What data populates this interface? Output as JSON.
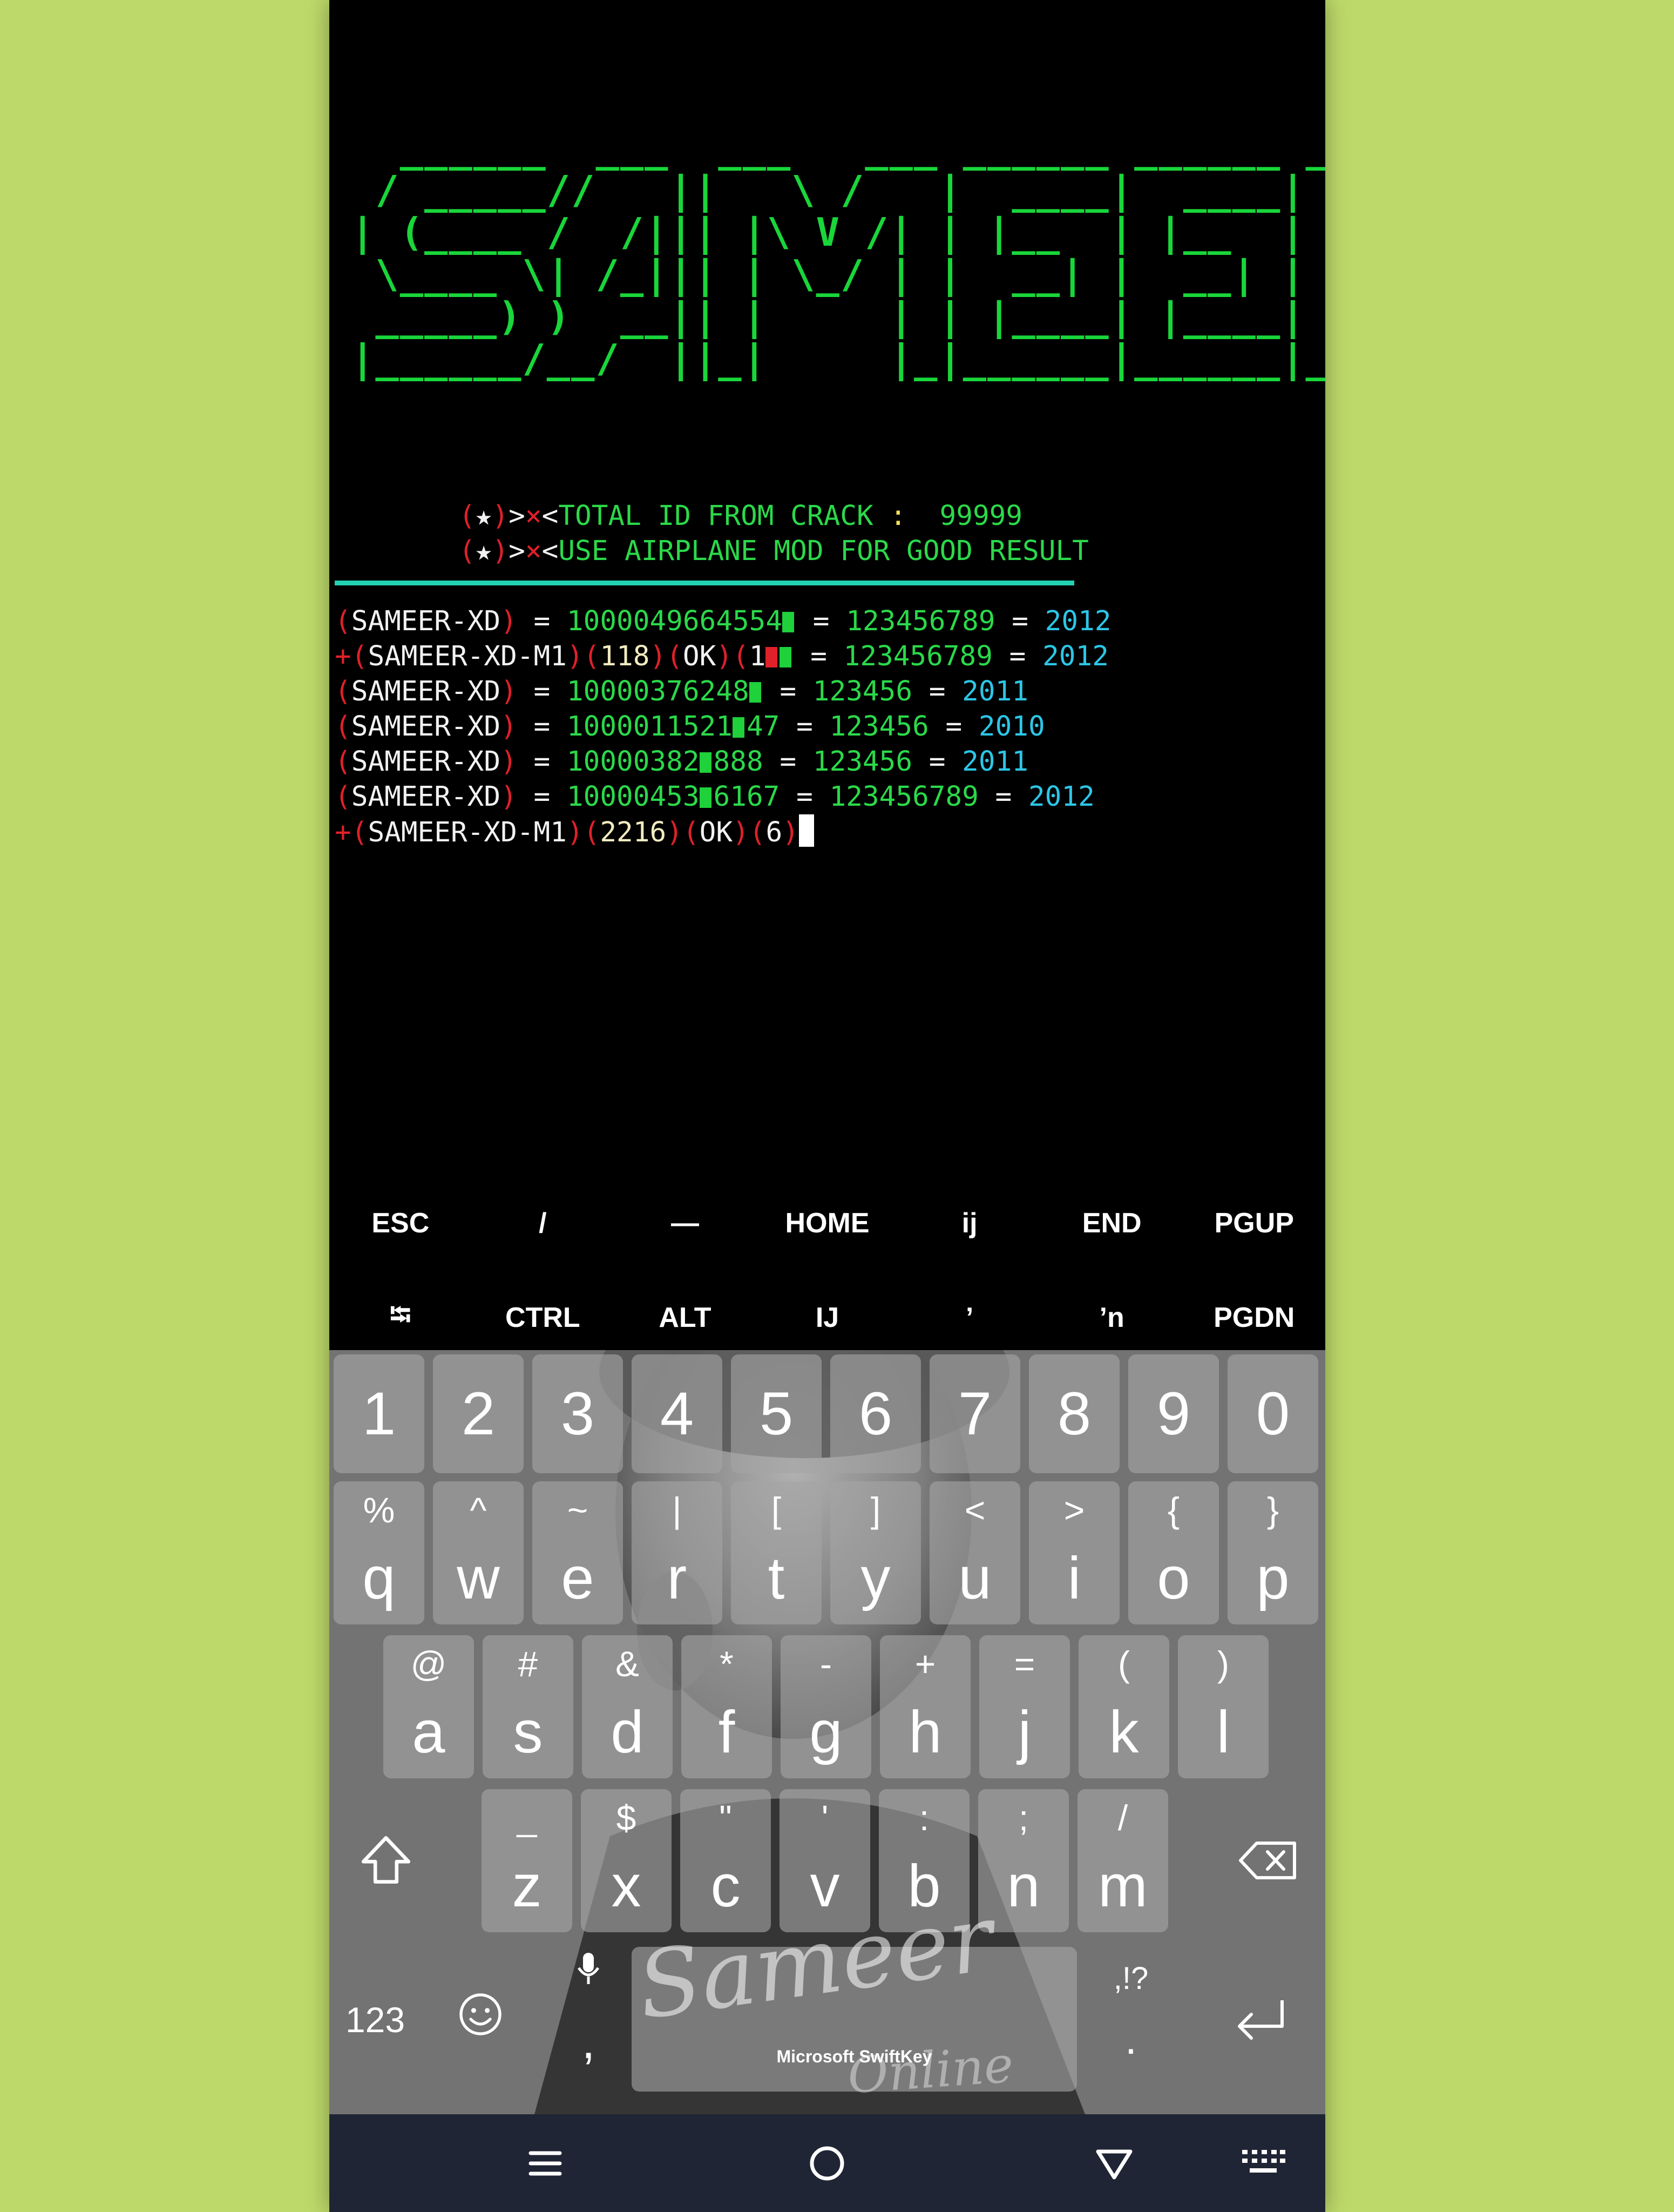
{
  "terminal": {
    "banner": [
      "  ______  ___  ___   ___ ______ ______ _____",
      " / _____//   ||   \\ /   |  ____|  ____|  __ \\",
      "| (____ /  /||| |\\ V /| | |__  | |__  | |__) |",
      " \\____ \\| /_||| | \\_/ | |  __| |  __| |  _  /",
      " _____) )  __|| |     | | |____| |____| | \\ \\",
      "|______/__/  ||_|     |_|______|______|_|  \\_\\"
    ],
    "info_lines": [
      {
        "prefix": "(",
        "star": "★",
        "suffix": ")>",
        "x": "×",
        "lt": "<",
        "text": "TOTAL ID FROM CRACK",
        "colon": " : ",
        "value": " 99999"
      },
      {
        "prefix": "(",
        "star": "★",
        "suffix": ")>",
        "x": "×",
        "lt": "<",
        "text": "USE AIRPLANE MOD FOR GOOD RESULT",
        "colon": "",
        "value": ""
      }
    ],
    "log_rows": [
      {
        "plus": "",
        "tag": "SAMEER-XD",
        "id": "1000049664554",
        "pass": "123456789",
        "year": "2012"
      },
      {
        "plus": "+",
        "tag": "SAMEER-XD-M1",
        "count": "118",
        "ok": "OK",
        "id": "1",
        "pass": "123456789",
        "year": "2012"
      },
      {
        "plus": "",
        "tag": "SAMEER-XD",
        "id": "10000376248",
        "pass": "123456",
        "year": "2011"
      },
      {
        "plus": "",
        "tag": "SAMEER-XD",
        "id": "1000011521",
        "id_tail": "47",
        "pass": "123456",
        "year": "2010"
      },
      {
        "plus": "",
        "tag": "SAMEER-XD",
        "id": "10000382",
        "id_tail": "888",
        "pass": "123456",
        "year": "2011"
      },
      {
        "plus": "",
        "tag": "SAMEER-XD",
        "id": "10000453",
        "id_tail": "6167",
        "pass": "123456789",
        "year": "2012"
      }
    ],
    "last_line": {
      "plus": "+",
      "tag": "SAMEER-XD-M1",
      "count": "2216",
      "ok": "OK",
      "num": "6"
    }
  },
  "extra_keys": {
    "row1": [
      "ESC",
      "/",
      "—",
      "HOME",
      "ij",
      "END",
      "PGUP"
    ],
    "row2": [
      "⭾",
      "CTRL",
      "ALT",
      "IJ",
      "’",
      "ʼn",
      "PGDN"
    ]
  },
  "keyboard": {
    "numbers": [
      "1",
      "2",
      "3",
      "4",
      "5",
      "6",
      "7",
      "8",
      "9",
      "0"
    ],
    "row_q": [
      {
        "sub": "%",
        "main": "q"
      },
      {
        "sub": "^",
        "main": "w"
      },
      {
        "sub": "~",
        "main": "e"
      },
      {
        "sub": "|",
        "main": "r"
      },
      {
        "sub": "[",
        "main": "t"
      },
      {
        "sub": "]",
        "main": "y"
      },
      {
        "sub": "<",
        "main": "u"
      },
      {
        "sub": ">",
        "main": "i"
      },
      {
        "sub": "{",
        "main": "o"
      },
      {
        "sub": "}",
        "main": "p"
      }
    ],
    "row_a": [
      {
        "sub": "@",
        "main": "a"
      },
      {
        "sub": "#",
        "main": "s"
      },
      {
        "sub": "&",
        "main": "d"
      },
      {
        "sub": "*",
        "main": "f"
      },
      {
        "sub": "-",
        "main": "g"
      },
      {
        "sub": "+",
        "main": "h"
      },
      {
        "sub": "=",
        "main": "j"
      },
      {
        "sub": "(",
        "main": "k"
      },
      {
        "sub": ")",
        "main": "l"
      }
    ],
    "row_z": [
      {
        "sub": "_",
        "main": "z"
      },
      {
        "sub": "$",
        "main": "x"
      },
      {
        "sub": "\"",
        "main": "c"
      },
      {
        "sub": "'",
        "main": "v"
      },
      {
        "sub": ":",
        "main": "b"
      },
      {
        "sub": ";",
        "main": "n"
      },
      {
        "sub": "/",
        "main": "m"
      }
    ],
    "shift_icon": "shift-icon",
    "backspace_icon": "backspace-icon",
    "symbols_label": "123",
    "comma": ",",
    "punct_label": ",!?",
    "period": ".",
    "space_brand": "Microsoft SwiftKey",
    "watermark": "Sameer",
    "watermark2": "Online"
  },
  "navbar": {
    "icons": [
      "menu-icon",
      "home-icon",
      "back-icon",
      "keyboard-icon"
    ]
  },
  "colors": {
    "banner": "#19d63a",
    "red": "#e0202a",
    "green": "#2bd94a",
    "cyan": "#2cc6e6",
    "divider": "#22d1b3",
    "background": "#bdd96a"
  }
}
